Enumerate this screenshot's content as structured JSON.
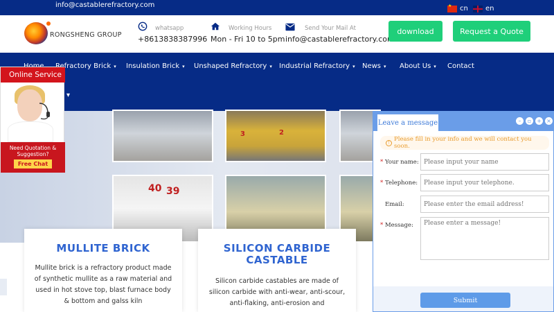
{
  "topbar": {
    "email": "info@castablerefractory.com",
    "lang_cn": "cn",
    "lang_en": "en"
  },
  "header": {
    "logo_text": "RONGSHENG GROUP",
    "whatsapp_label": "whatsapp",
    "whatsapp_value": "+8613838387996",
    "hours_label": "Working Hours",
    "hours_value": "Mon - Fri 10 to 5pm",
    "mail_label": "Send Your Mail At",
    "mail_value": "info@castablerefractory.com",
    "download_label": "download",
    "quote_label": "Request a Quote"
  },
  "nav": {
    "items": [
      {
        "label": "Home"
      },
      {
        "label": "Refractory Brick"
      },
      {
        "label": "Insulation Brick"
      },
      {
        "label": "Unshaped Refractory"
      },
      {
        "label": "Industrial Refractory"
      },
      {
        "label": "News"
      },
      {
        "label": "About Us"
      },
      {
        "label": "Contact"
      }
    ],
    "second_row_chevron": "▾"
  },
  "banner": {
    "hopper_numbers": [
      "3",
      "2"
    ],
    "bin_numbers": [
      "40",
      "39"
    ]
  },
  "cards": [
    {
      "title": "MULLITE BRICK",
      "text": "Mullite brick is a refractory product made of synthetic mullite as a raw material and used in hot stove top, blast furnace body & bottom and galss kiln"
    },
    {
      "title": "SILICON CARBIDE CASTABLE",
      "text": "Silicon carbide castables are made of silicon carbide with anti-wear, anti-scour, anti-flaking, anti-erosion and"
    }
  ],
  "online_service": {
    "title": "Online Service",
    "caption_line1": "Need Quotation &",
    "caption_line2": "Suggestion?",
    "free_chat": "Free Chat"
  },
  "message_widget": {
    "tab_label": "Leave a message",
    "notice": "Please fill in your info and we will contact you soon.",
    "fields": {
      "name": {
        "label": "Your name:",
        "placeholder": "Please input your name",
        "required": true
      },
      "phone": {
        "label": "Telephone:",
        "placeholder": "Please input your telephone.",
        "required": true
      },
      "email": {
        "label": "Email:",
        "placeholder": "Please enter the email address!",
        "required": false
      },
      "message": {
        "label": "Message:",
        "placeholder": "Please enter a message!",
        "required": true
      }
    },
    "submit_label": "Submit"
  },
  "colors": {
    "navy": "#062b86",
    "green": "#1fcf7a",
    "card_title": "#2f64d0",
    "online_red": "#d3141c",
    "widget_blue": "#6a9de8"
  }
}
